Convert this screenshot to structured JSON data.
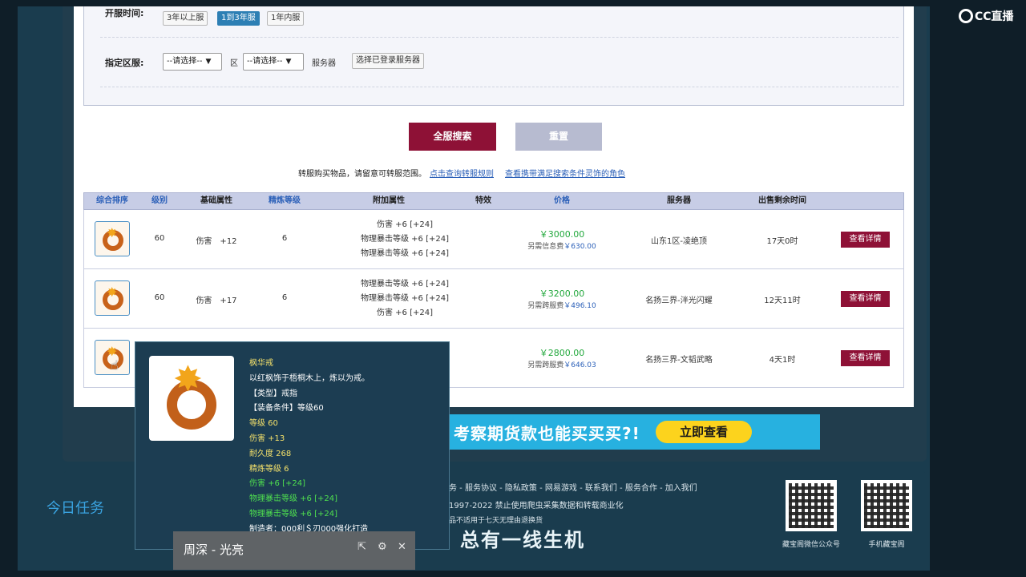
{
  "logo": {
    "text": "CC直播"
  },
  "filters": {
    "server_age_label": "开服时间:",
    "server_age_options": [
      "3年以上服",
      "1到3年服",
      "1年内服"
    ],
    "server_age_selected": "1到3年服",
    "zone_label": "指定区服:",
    "zone_select_1": "--请选择--",
    "zone_unit": "区",
    "zone_select_2": "--请选择--",
    "server_unit": "服务器",
    "choose_logged_server": "选择已登录服务器"
  },
  "actions": {
    "search_all": "全服搜索",
    "reset": "重置"
  },
  "notice": {
    "text": "转服购买物品，请留意可转服范围。",
    "link1": "点击查询转服规则",
    "link2": "查看携带满足搜索条件灵饰的角色"
  },
  "table": {
    "headers": [
      "综合排序",
      "级别",
      "基础属性",
      "精炼等级",
      "附加属性",
      "特效",
      "价格",
      "服务器",
      "出售剩余时间"
    ],
    "rows": [
      {
        "level": "60",
        "base_attr": "伤害　+12",
        "refine": "6",
        "attrs": [
          "伤害 +6 [+24]",
          "物理暴击等级 +6 [+24]",
          "物理暴击等级 +6 [+24]"
        ],
        "price": "￥3000.00",
        "subprice_label": "另需信息费",
        "subprice_value": "￥630.00",
        "server": "山东1区-凌绝顶",
        "remaining": "17天0时",
        "detail": "查看详情"
      },
      {
        "level": "60",
        "base_attr": "伤害　+17",
        "refine": "6",
        "attrs": [
          "物理暴击等级 +6 [+24]",
          "物理暴击等级 +6 [+24]",
          "伤害 +6 [+24]"
        ],
        "price": "￥3200.00",
        "subprice_label": "另需跨服费",
        "subprice_value": "￥496.10",
        "server": "名扬三界-泮光闪耀",
        "remaining": "12天11时",
        "detail": "查看详情"
      },
      {
        "level": "",
        "base_attr": "",
        "refine": "",
        "attrs": [],
        "price": "￥2800.00",
        "subprice_label": "另需跨服费",
        "subprice_value": "￥646.03",
        "server": "名扬三界-文韬武略",
        "remaining": "4天1时",
        "detail": "查看详情"
      }
    ]
  },
  "tooltip": {
    "name": "枫华戒",
    "desc": "以红枫饰于梧桐木上，炼以为戒。",
    "type": "【类型】戒指",
    "req": "【装备条件】等级60",
    "level": "等级 60",
    "damage": "伤害 +13",
    "durability": "耐久度 268",
    "refine": "精炼等级 6",
    "bonus1": "伤害 +6 [+24]",
    "bonus2": "物理暴击等级 +6 [+24]",
    "bonus3": "物理暴击等级 +6 [+24]",
    "maker": "制造者：000利＄刃000强化打造"
  },
  "banner": {
    "text": "考察期货款也能买买买?!",
    "button": "立即查看"
  },
  "footer": {
    "links": "务 - 服务协议 - 隐私政策 - 网易游戏 - 联系我们 - 服务合作 - 加入我们",
    "copyright": "1997-2022 禁止使用爬虫采集数据和转载商业化",
    "note": "品不适用于七天无理由退换货",
    "slogan": "总有一线生机",
    "qr1_label": "藏宝阁微信公众号",
    "qr2_label": "手机藏宝阁"
  },
  "side": {
    "task": "今日任务"
  },
  "toast": {
    "title": "周深 - 光亮"
  }
}
